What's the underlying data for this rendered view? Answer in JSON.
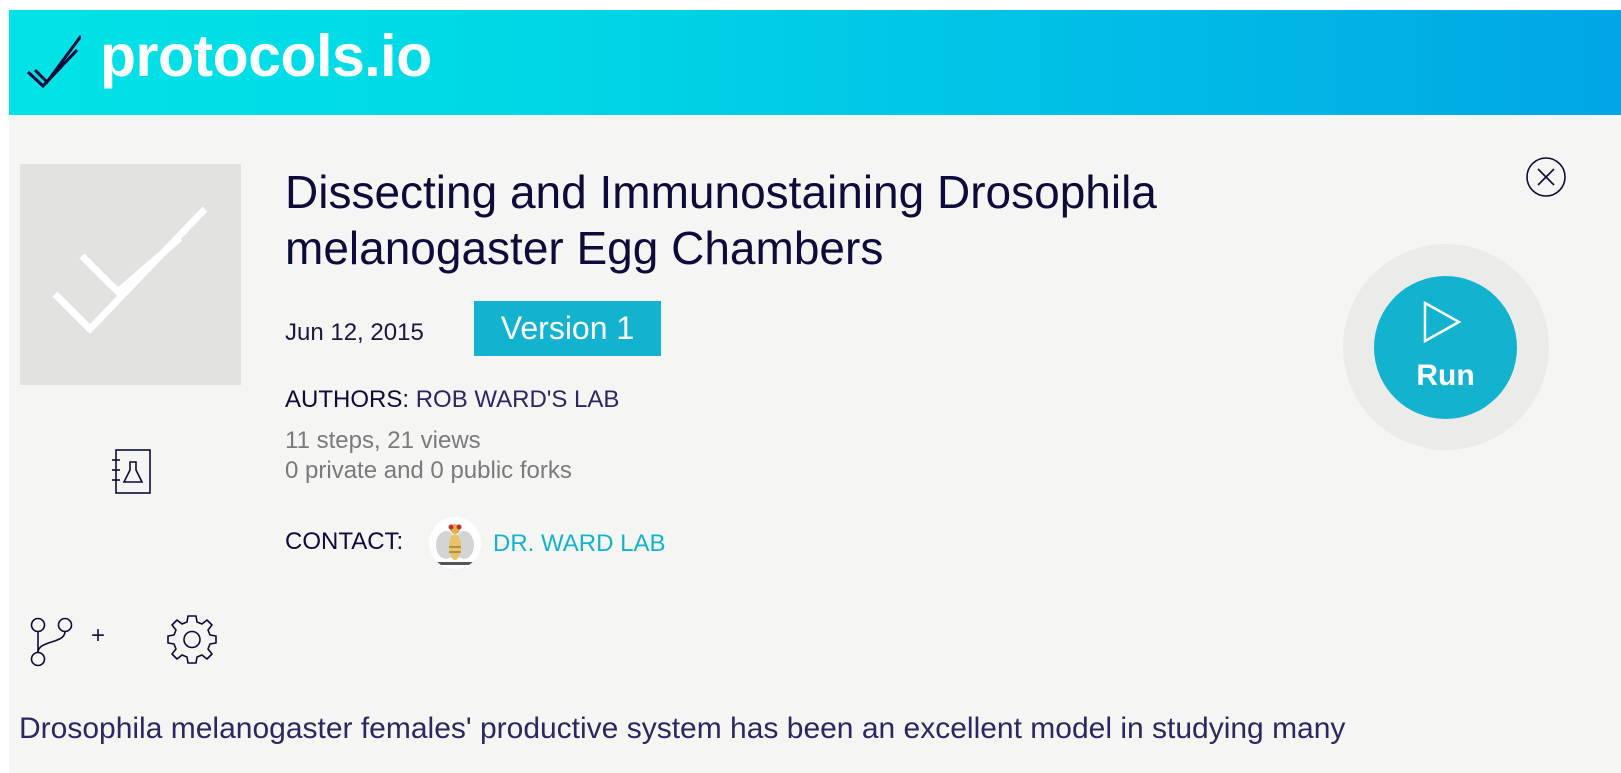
{
  "header": {
    "logo_text": "protocols.io",
    "background_colors": [
      "#00e3e6",
      "#00a6e6"
    ]
  },
  "protocol": {
    "title": "Dissecting and Immunostaining Drosophila melanogaster Egg Chambers",
    "date": "Jun 12, 2015",
    "version_label": "Version 1",
    "authors_label": "AUTHORS:",
    "authors_value": "ROB WARD'S LAB",
    "stats_line1": "11 steps, 21 views",
    "stats_line2": "0 private and 0 public forks",
    "contact_label": "CONTACT:",
    "contact_name": "DR. WARD LAB",
    "description": "Drosophila melanogaster females' productive system has been an excellent model in studying many"
  },
  "actions": {
    "run_label": "Run",
    "fork_plus": "+"
  },
  "icons": {
    "logo": "checkmark-logo-icon",
    "thumbnail": "checkmark-placeholder-icon",
    "notebook": "lab-notebook-icon",
    "close": "close-icon",
    "run": "play-icon",
    "fork": "fork-icon",
    "settings": "gear-icon"
  },
  "colors": {
    "accent": "#13b3cf",
    "title": "#0d0b3a",
    "muted": "#7a7a7a",
    "panel": "#f5f5f4"
  }
}
